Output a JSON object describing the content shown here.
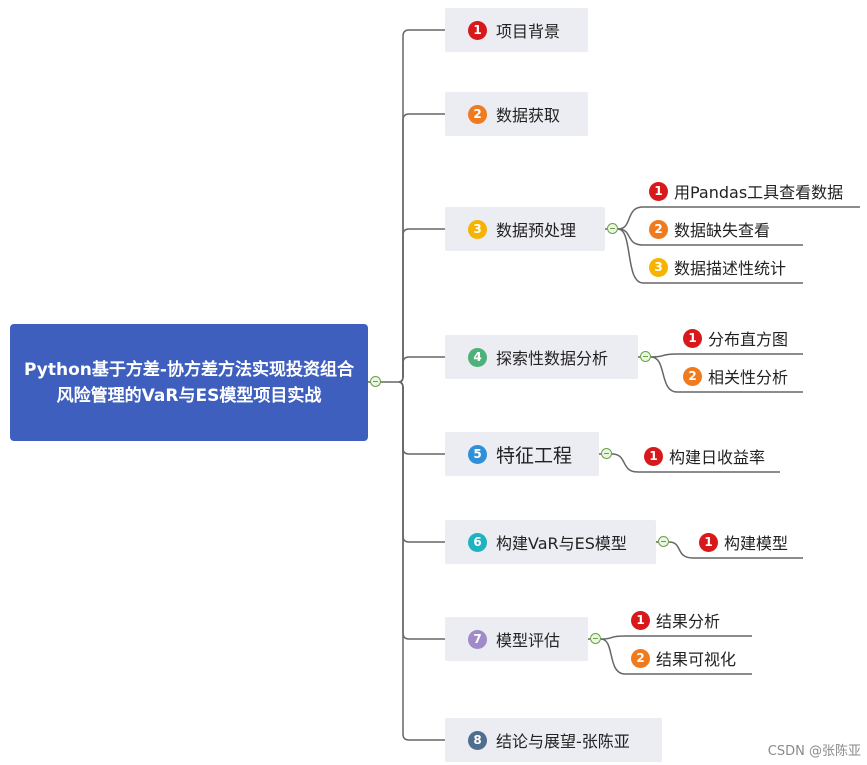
{
  "root": {
    "title": "Python基于方差-协方差方法实现投资组合风险管理的VaR与ES模型项目实战"
  },
  "colors": {
    "root_bg": "#3f5fbf",
    "node_bg": "#ececf3",
    "line": "#666666",
    "badge": [
      "#d7191c",
      "#f07a1e",
      "#f5b400",
      "#4cb27a",
      "#2f8fd8",
      "#1fb2c0",
      "#a08ac8",
      "#4f6d8c"
    ]
  },
  "branches": [
    {
      "num": "1",
      "label": "项目背景",
      "children": []
    },
    {
      "num": "2",
      "label": "数据获取",
      "children": []
    },
    {
      "num": "3",
      "label": "数据预处理",
      "children": [
        {
          "num": "1",
          "label": "用Pandas工具查看数据"
        },
        {
          "num": "2",
          "label": "数据缺失查看"
        },
        {
          "num": "3",
          "label": "数据描述性统计"
        }
      ]
    },
    {
      "num": "4",
      "label": "探索性数据分析",
      "children": [
        {
          "num": "1",
          "label": "分布直方图"
        },
        {
          "num": "2",
          "label": "相关性分析"
        }
      ]
    },
    {
      "num": "5",
      "label": "特征工程",
      "children": [
        {
          "num": "1",
          "label": "构建日收益率"
        }
      ]
    },
    {
      "num": "6",
      "label": "构建VaR与ES模型",
      "children": [
        {
          "num": "1",
          "label": "构建模型"
        }
      ]
    },
    {
      "num": "7",
      "label": "模型评估",
      "children": [
        {
          "num": "1",
          "label": "结果分析"
        },
        {
          "num": "2",
          "label": "结果可视化"
        }
      ]
    },
    {
      "num": "8",
      "label": "结论与展望-张陈亚",
      "children": []
    }
  ],
  "watermark": "CSDN @张陈亚"
}
